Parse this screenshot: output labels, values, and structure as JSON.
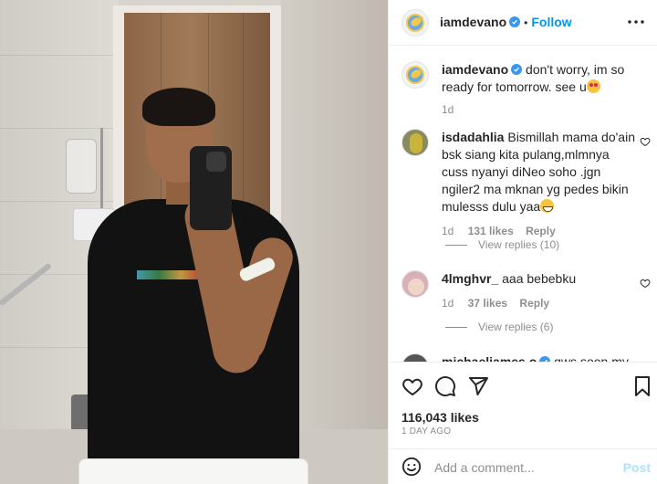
{
  "header": {
    "username": "iamdevano",
    "follow_label": "Follow",
    "dot": "•"
  },
  "caption": {
    "username": "iamdevano",
    "text": "don't worry, im so ready for tomorrow. see u",
    "time": "1d"
  },
  "comments": [
    {
      "username": "isdadahlia",
      "text": "Bismillah mama do'ain bsk siang kita pulang,mlmnya cuss nyanyi diNeo soho .jgn ngiler2 ma mknan yg pedes bikin mulesss dulu yaa",
      "time": "1d",
      "likes": "131 likes",
      "reply_label": "Reply",
      "view_replies": "View replies (10)"
    },
    {
      "username": "4lmghvr_",
      "text": "aaa bebebku",
      "time": "1d",
      "likes": "37 likes",
      "reply_label": "Reply",
      "view_replies": "View replies (6)"
    },
    {
      "username": "michaeljames.o",
      "text": "gws soon my"
    }
  ],
  "stats": {
    "likes": "116,043 likes",
    "ago": "1 DAY AGO"
  },
  "comment_box": {
    "placeholder": "Add a comment...",
    "post_label": "Post"
  },
  "icons": {
    "verified": "verified-badge-icon",
    "more": "more-options-icon",
    "like": "heart-icon",
    "comment": "comment-icon",
    "share": "share-icon",
    "save": "bookmark-icon",
    "emoji": "emoji-icon"
  },
  "colors": {
    "link": "#0095f6",
    "verified": "#3897f0",
    "muted": "#8e8e8e",
    "post_disabled": "#b2dffc"
  }
}
